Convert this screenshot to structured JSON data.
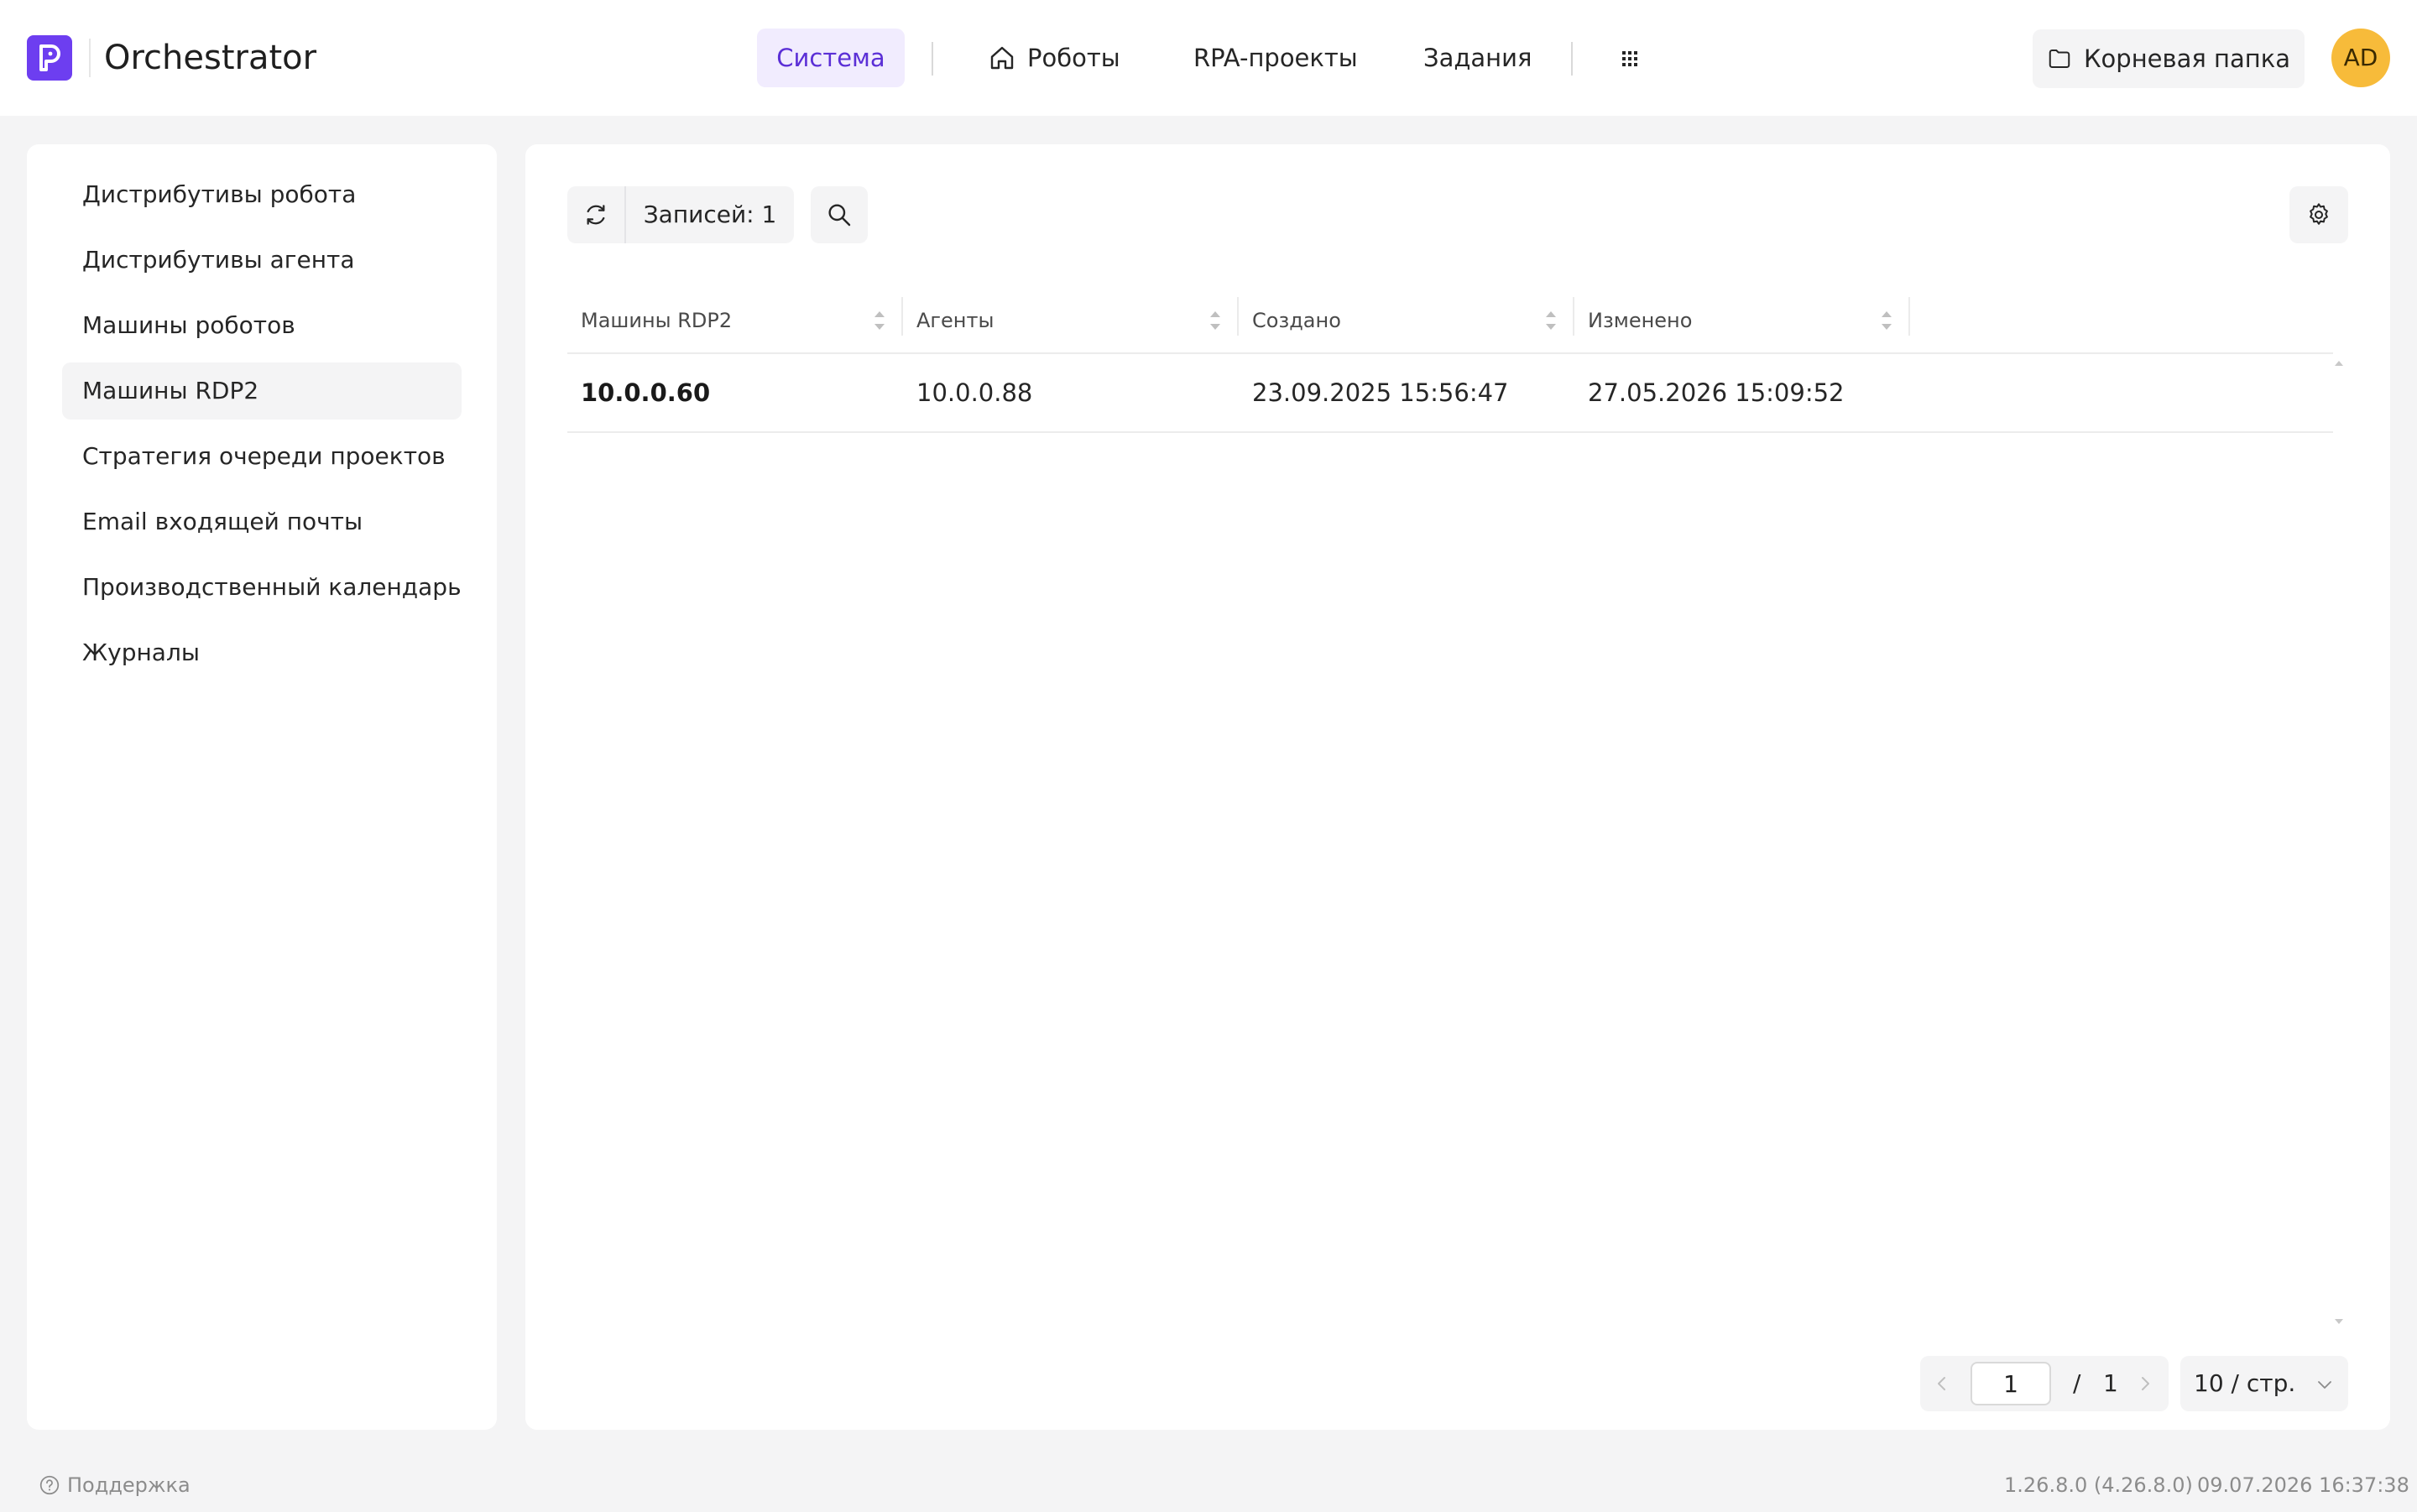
{
  "header": {
    "app_title": "Orchestrator",
    "nav": {
      "system": "Система",
      "robots": "Роботы",
      "rpa_projects": "RPA-проекты",
      "tasks": "Задания"
    },
    "folder_button": "Корневая папка",
    "avatar_initials": "AD",
    "accent_color": "#6d3ef0",
    "avatar_color": "#f7bb3a"
  },
  "sidebar": {
    "items": [
      {
        "label": "Дистрибутивы робота"
      },
      {
        "label": "Дистрибутивы агента"
      },
      {
        "label": "Машины роботов"
      },
      {
        "label": "Машины RDP2",
        "active": true
      },
      {
        "label": "Стратегия очереди проектов"
      },
      {
        "label": "Email входящей почты"
      },
      {
        "label": "Производственный календарь"
      },
      {
        "label": "Журналы"
      }
    ]
  },
  "toolbar": {
    "records_label": "Записей: 1"
  },
  "table": {
    "columns": [
      "Машины RDP2",
      "Агенты",
      "Создано",
      "Изменено"
    ],
    "rows": [
      [
        "10.0.0.60",
        "10.0.0.88",
        "23.09.2025 15:56:47",
        "27.05.2026 15:09:52"
      ]
    ]
  },
  "pagination": {
    "current_page": "1",
    "separator": "/",
    "total_pages": "1",
    "page_size": "10 / стр."
  },
  "footer": {
    "support": "Поддержка",
    "version": "1.26.8.0 (4.26.8.0)",
    "datetime": "09.07.2026 16:37:38"
  }
}
